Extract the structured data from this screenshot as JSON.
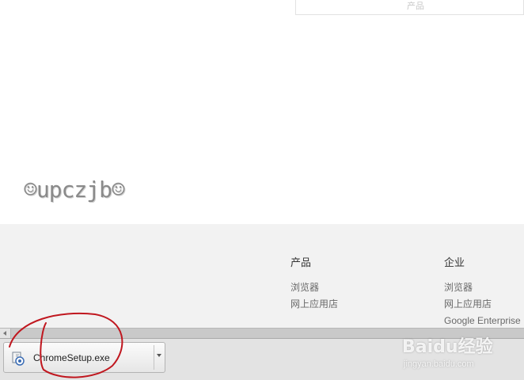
{
  "top_card": {
    "text": "产品"
  },
  "watermark": {
    "text": "☺upczjb☺"
  },
  "footer": {
    "products": {
      "title": "产品",
      "links": [
        "浏览器",
        "网上应用店"
      ]
    },
    "enterprise": {
      "title": "企业",
      "links": [
        "浏览器",
        "网上应用店",
        "Google Enterprise"
      ]
    }
  },
  "download_shelf": {
    "file_name": "ChromeSetup.exe"
  },
  "overlay": {
    "logo": "Baidu经验",
    "url": "jingyan.baidu.com"
  },
  "colors": {
    "footer_bg": "#f2f2f2",
    "shelf_bg": "#e3e3e3",
    "annotation": "#c0171f"
  }
}
